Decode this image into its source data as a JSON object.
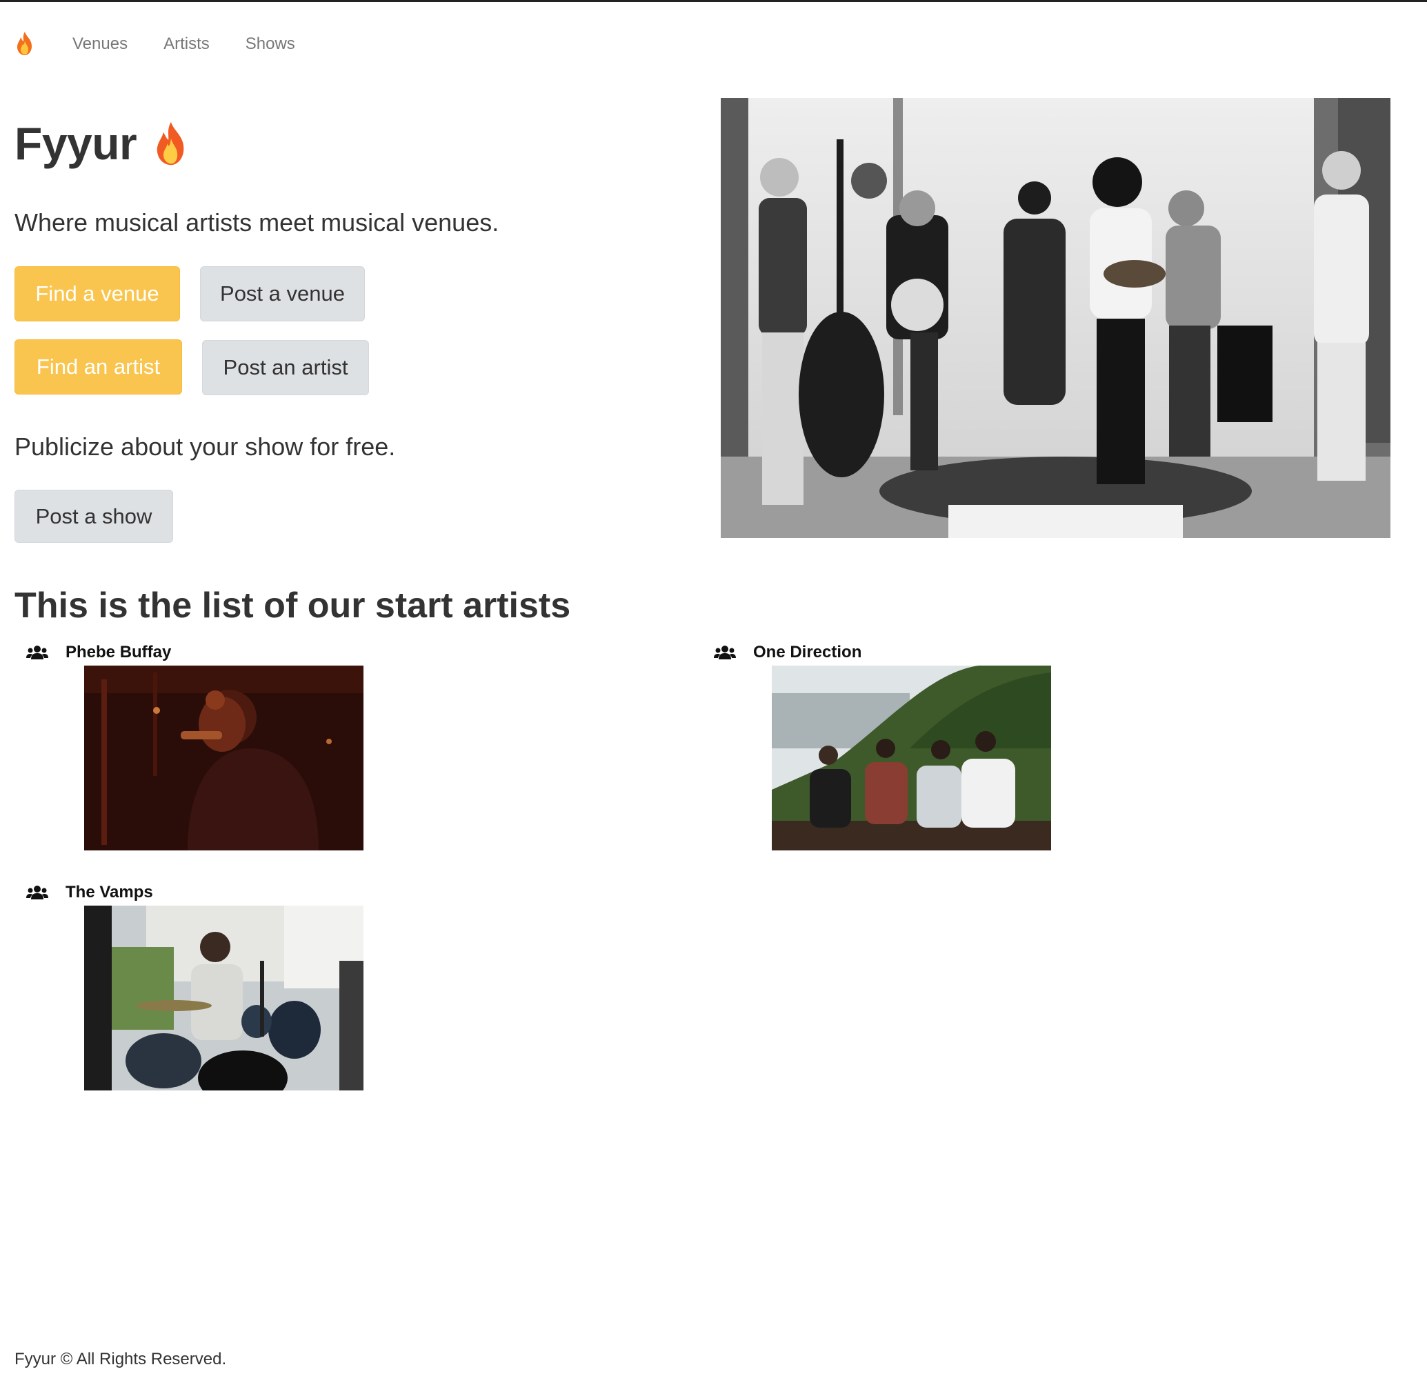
{
  "nav": {
    "brand_icon": "fire-icon",
    "links": [
      "Venues",
      "Artists",
      "Shows"
    ]
  },
  "hero": {
    "title": "Fyyur",
    "title_icon": "fire-icon",
    "lead_venues": "Where musical artists meet musical venues.",
    "buttons": {
      "find_venue": "Find a venue",
      "post_venue": "Post a venue",
      "find_artist": "Find an artist",
      "post_artist": "Post an artist",
      "post_show": "Post a show"
    },
    "lead_show": "Publicize about your show for free.",
    "photo": "band-performance-photo"
  },
  "artists": {
    "title": "This is the list of our start artists",
    "items": [
      {
        "name": "Phebe Buffay",
        "icon": "users-icon",
        "photo": "singer-on-stage-photo"
      },
      {
        "name": "One Direction",
        "icon": "users-icon",
        "photo": "group-on-hillside-photo"
      },
      {
        "name": "The Vamps",
        "icon": "users-icon",
        "photo": "drummer-photo"
      }
    ]
  },
  "footer": {
    "text": "Fyyur © All Rights Reserved."
  },
  "colors": {
    "warning": "#f9c54e",
    "default_button": "#dee1e4",
    "text": "#333333",
    "nav_link": "#777777"
  }
}
